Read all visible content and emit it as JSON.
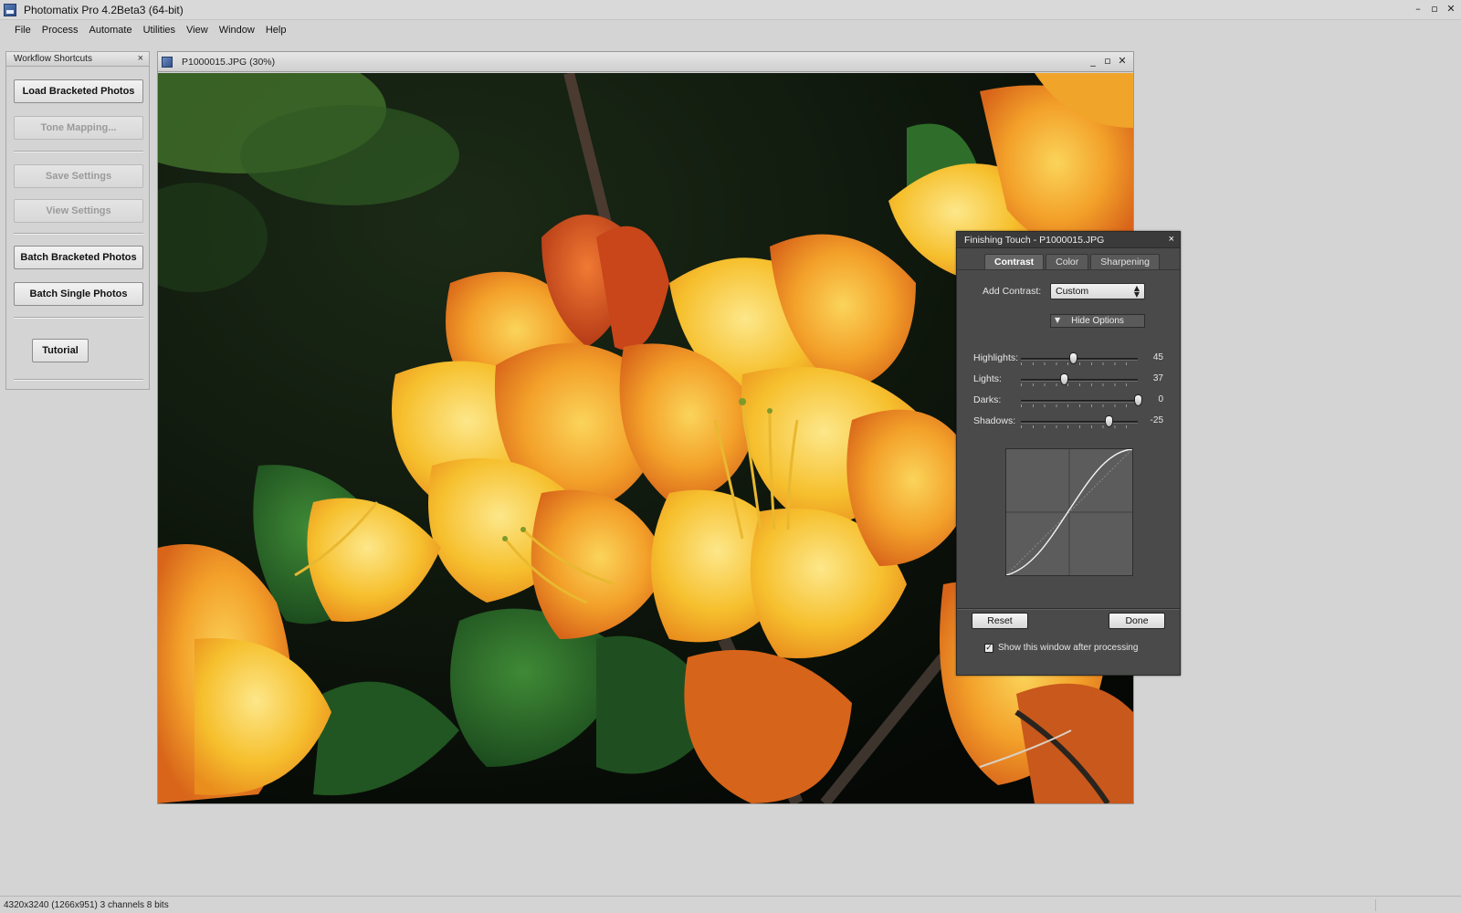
{
  "app": {
    "title": "Photomatix Pro 4.2Beta3 (64-bit)",
    "window_controls": {
      "minimize": "–",
      "restore": "▫",
      "close": "✕"
    }
  },
  "menu": [
    "File",
    "Process",
    "Automate",
    "Utilities",
    "View",
    "Window",
    "Help"
  ],
  "workflow": {
    "title": "Workflow Shortcuts",
    "close": "×",
    "buttons": {
      "load": "Load Bracketed Photos",
      "tone": "Tone Mapping...",
      "save": "Save Settings",
      "view": "View Settings",
      "batch_bracketed": "Batch Bracketed Photos",
      "batch_single": "Batch Single Photos",
      "tutorial": "Tutorial"
    }
  },
  "image_window": {
    "title": "P1000015.JPG (30%)",
    "controls": {
      "minimize": "_",
      "restore": "▫",
      "close": "✕"
    }
  },
  "finishing": {
    "title": "Finishing Touch - P1000015.JPG",
    "close": "×",
    "tabs": [
      "Contrast",
      "Color",
      "Sharpening"
    ],
    "active_tab": "Contrast",
    "add_contrast_label": "Add Contrast:",
    "add_contrast_value": "Custom",
    "hide_options": "Hide Options",
    "sliders": [
      {
        "label": "Highlights:",
        "value": "45",
        "position": 0.45
      },
      {
        "label": "Lights:",
        "value": "37",
        "position": 0.37
      },
      {
        "label": "Darks:",
        "value": "0",
        "position": 1.0
      },
      {
        "label": "Shadows:",
        "value": "-25",
        "position": 0.75
      }
    ],
    "reset": "Reset",
    "done": "Done",
    "show_after_label": "Show this window after processing",
    "show_after_checked": true
  },
  "status": {
    "text": "4320x3240 (1266x951) 3 channels 8 bits"
  },
  "colors": {
    "dialog_bg": "#4a4a4a",
    "panel_bg": "#d4d4d4",
    "flower_orange": "#f08a1c",
    "flower_yellow": "#f7c12a"
  }
}
